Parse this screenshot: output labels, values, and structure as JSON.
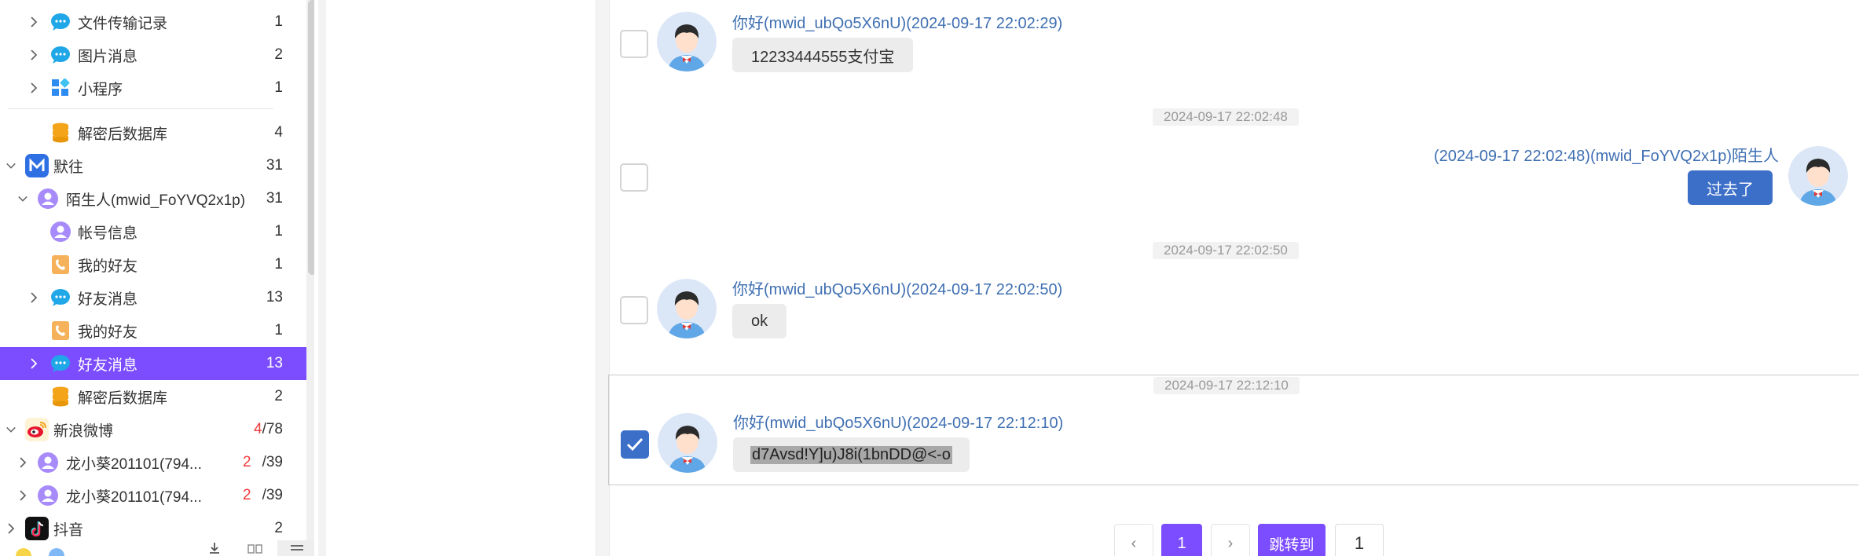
{
  "sidebar": {
    "items": [
      {
        "label": "文件传输记录",
        "count": "1",
        "icon": "chat-bubble-icon"
      },
      {
        "label": "图片消息",
        "count": "2",
        "icon": "chat-bubble-icon"
      },
      {
        "label": "小程序",
        "count": "1",
        "icon": "mini-program-icon"
      },
      {
        "label": "解密后数据库",
        "count": "4",
        "icon": "database-icon"
      },
      {
        "label": "默往",
        "count": "31",
        "icon": "mowang-app-icon"
      },
      {
        "label": "陌生人(mwid_FoYVQ2x1p)",
        "count": "31",
        "icon": "user-icon"
      },
      {
        "label": "帐号信息",
        "count": "1",
        "icon": "user-icon"
      },
      {
        "label": "我的好友",
        "count": "1",
        "icon": "contacts-icon"
      },
      {
        "label": "好友消息",
        "count": "13",
        "icon": "chat-bubble-icon"
      },
      {
        "label": "我的好友",
        "count": "1",
        "icon": "contacts-icon"
      },
      {
        "label": "好友消息",
        "count": "13",
        "icon": "chat-bubble-icon"
      },
      {
        "label": "解密后数据库",
        "count": "2",
        "icon": "database-icon"
      },
      {
        "label": "新浪微博",
        "count_red": "4",
        "count_total": "/78",
        "icon": "weibo-icon"
      },
      {
        "label": "龙小葵201101(794...",
        "count_red": "2",
        "count_total": "/39",
        "icon": "user-icon"
      },
      {
        "label": "龙小葵201101(794...",
        "count_red": "2",
        "count_total": "/39",
        "icon": "user-icon"
      },
      {
        "label": "抖音",
        "count": "2",
        "icon": "douyin-icon"
      }
    ],
    "selected_index": 10
  },
  "chat": {
    "messages": [
      {
        "sender": "你好(mwid_ubQo5X6nU)(2024-09-17 22:02:29)",
        "text": "12233444555支付宝",
        "side": "left",
        "checked": false
      },
      {
        "timestamp": "2024-09-17 22:02:48",
        "sender": "(2024-09-17 22:02:48)(mwid_FoYVQ2x1p)陌生人",
        "text": "过去了",
        "side": "right",
        "checked": false
      },
      {
        "timestamp": "2024-09-17 22:02:50",
        "sender": "你好(mwid_ubQo5X6nU)(2024-09-17 22:02:50)",
        "text": "ok",
        "side": "left",
        "checked": false
      },
      {
        "timestamp": "2024-09-17 22:12:10",
        "sender": "你好(mwid_ubQo5X6nU)(2024-09-17 22:12:10)",
        "text": "d7Avsd!Y]u)J8i(1bnDD@<-o",
        "side": "left",
        "checked": true
      }
    ]
  },
  "pagination": {
    "prev": "‹",
    "current": "1",
    "next": "›",
    "jump_label": "跳转到",
    "jump_value": "1"
  },
  "colors": {
    "accent": "#7c4dff",
    "sender": "#3f6fb2",
    "bubble_right": "#3c6fc8",
    "count_red": "#f03a3a"
  }
}
